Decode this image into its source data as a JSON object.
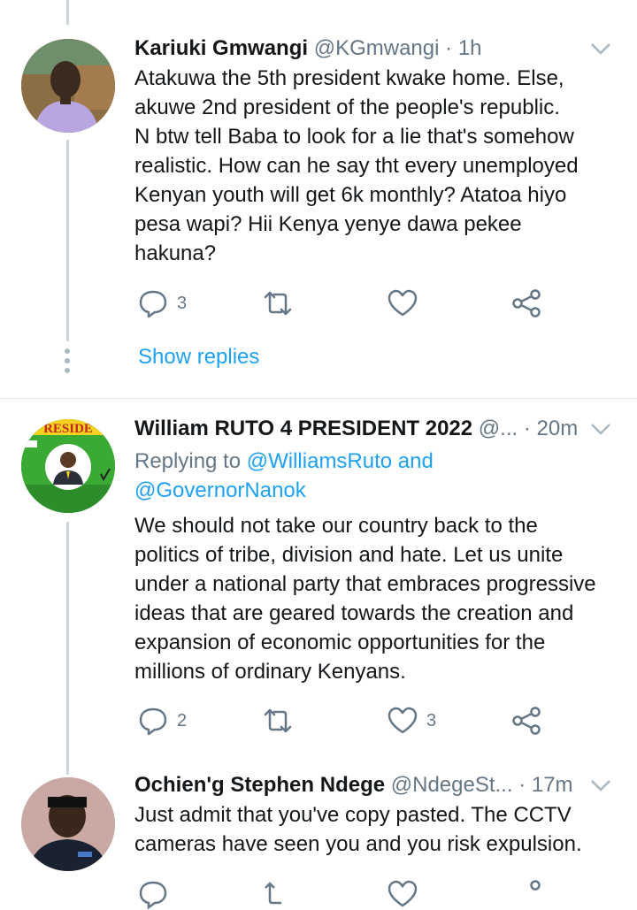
{
  "tweets": [
    {
      "name": "Kariuki Gmwangi",
      "handle": "@KGmwangi",
      "dot": "·",
      "time": "1h",
      "lines": [
        "Atakuwa the 5th president kwake home. Else,",
        "akuwe 2nd president of the people's republic.",
        "N btw tell Baba to look for a lie that's somehow",
        "realistic. How can he say tht every unemployed",
        "Kenyan youth will get 6k monthly? Atatoa hiyo",
        "pesa wapi? Hii Kenya yenye dawa pekee",
        "hakuna?"
      ],
      "reply_count": "3",
      "retweet_count": "",
      "like_count": "",
      "show_replies": "Show replies",
      "avatar_icon": "person-photo-icon"
    },
    {
      "name": "William RUTO 4 PRESIDENT 2022",
      "handle": "@...",
      "dot": "·",
      "time": "20m",
      "replying_prefix": "Replying to",
      "replying_to_1": "@WilliamsRuto and",
      "replying_to_2": "@GovernorNanok",
      "lines": [
        "We should not take our country back to the",
        "politics of tribe, division and hate. Let us unite",
        "under a national party that embraces progressive",
        "ideas that are geared towards the creation and",
        "expansion of economic opportunities for the",
        "millions of ordinary Kenyans."
      ],
      "reply_count": "2",
      "retweet_count": "",
      "like_count": "3",
      "avatar_text": "RESIDE",
      "avatar_icon": "campaign-poster-icon"
    },
    {
      "name": "Ochien'g Stephen Ndege",
      "handle": "@NdegeSt...",
      "dot": "·",
      "time": "17m",
      "lines": [
        "Just admit that you've copy pasted. The CCTV",
        "cameras have seen you and you risk expulsion."
      ],
      "avatar_icon": "person-photo-icon"
    }
  ],
  "colors": {
    "link": "#1da1f2",
    "muted": "#657786",
    "thread_line": "#ccd6dd",
    "avatar_green": "#3aaa35"
  }
}
